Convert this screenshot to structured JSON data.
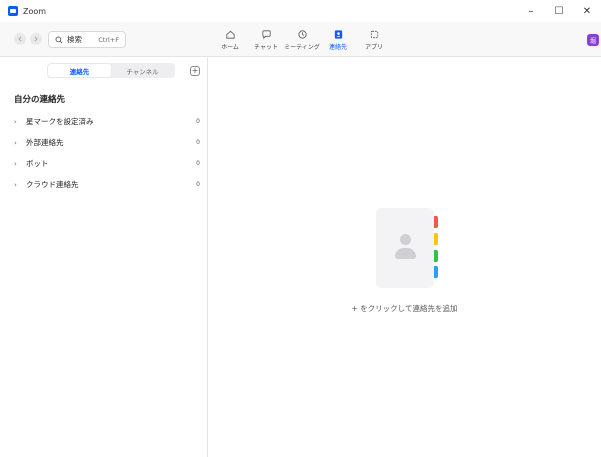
{
  "window": {
    "title": "Zoom",
    "controls": {
      "minimize": "–",
      "maximize": "☐",
      "close": "✕"
    }
  },
  "toolbar": {
    "back_icon": "chevron-left-icon",
    "forward_icon": "chevron-right-icon",
    "search": {
      "label": "検索",
      "shortcut": "Ctrl+F",
      "icon": "search-icon"
    },
    "tabs": [
      {
        "label": "ホーム",
        "icon": "home-icon",
        "active": false
      },
      {
        "label": "チャット",
        "icon": "chat-icon",
        "active": false
      },
      {
        "label": "ミーティング",
        "icon": "clock-icon",
        "active": false
      },
      {
        "label": "連絡先",
        "icon": "contacts-icon",
        "active": true
      },
      {
        "label": "アプリ",
        "icon": "apps-icon",
        "active": false
      }
    ],
    "avatar_initials": "堀"
  },
  "sidebar": {
    "segments": [
      {
        "label": "連絡先",
        "active": true
      },
      {
        "label": "チャンネル",
        "active": false
      }
    ],
    "add_label": "+",
    "section_title": "自分の連絡先",
    "groups": [
      {
        "label": "星マークを設定済み",
        "count": "0"
      },
      {
        "label": "外部連絡先",
        "count": "0"
      },
      {
        "label": "ボット",
        "count": "0"
      },
      {
        "label": "クラウド連絡先",
        "count": "0"
      }
    ]
  },
  "main": {
    "empty_message": "+ をクリックして連絡先を追加",
    "illustration_icon": "address-book-icon"
  },
  "colors": {
    "accent": "#0b5cff",
    "tab_red": "#f0584f",
    "tab_yellow": "#f5c518",
    "tab_green": "#2fbf4a",
    "tab_blue": "#2f9df5",
    "avatar": "#8a3fd1"
  }
}
